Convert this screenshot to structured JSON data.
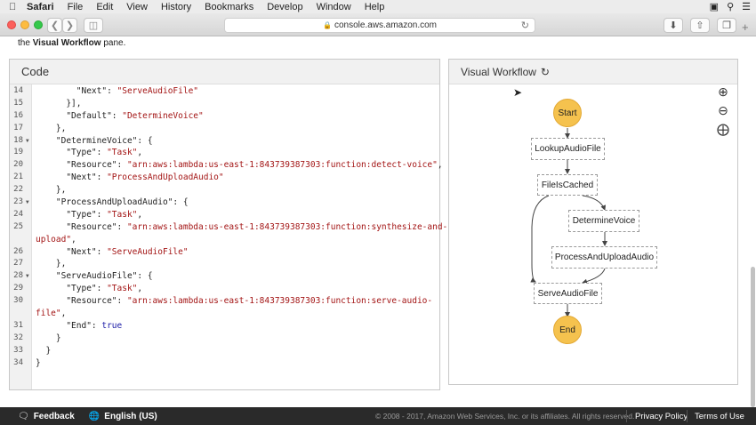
{
  "menubar": {
    "app": "Safari",
    "items": [
      "File",
      "Edit",
      "View",
      "History",
      "Bookmarks",
      "Develop",
      "Window",
      "Help"
    ]
  },
  "browser": {
    "url": "console.aws.amazon.com"
  },
  "intro": {
    "prefix": "the ",
    "bold": "Visual Workflow",
    "suffix": " pane."
  },
  "code_panel": {
    "title": "Code",
    "lines": [
      {
        "n": "14",
        "fold": false,
        "parts": [
          [
            "k",
            "        \"Next\": "
          ],
          [
            "s",
            "\"ServeAudioFile\""
          ]
        ]
      },
      {
        "n": "15",
        "fold": false,
        "parts": [
          [
            "k",
            "      }],"
          ]
        ]
      },
      {
        "n": "16",
        "fold": false,
        "parts": [
          [
            "k",
            "      \"Default\": "
          ],
          [
            "s",
            "\"DetermineVoice\""
          ]
        ]
      },
      {
        "n": "17",
        "fold": false,
        "parts": [
          [
            "k",
            "    },"
          ]
        ]
      },
      {
        "n": "18",
        "fold": true,
        "parts": [
          [
            "k",
            "    \"DetermineVoice\": {"
          ]
        ]
      },
      {
        "n": "19",
        "fold": false,
        "parts": [
          [
            "k",
            "      \"Type\": "
          ],
          [
            "s",
            "\"Task\""
          ],
          [
            "k",
            ","
          ]
        ]
      },
      {
        "n": "20",
        "fold": false,
        "parts": [
          [
            "k",
            "      \"Resource\": "
          ],
          [
            "s",
            "\"arn:aws:lambda:us-east-1:843739387303:function:detect-voice\""
          ],
          [
            "k",
            ","
          ]
        ]
      },
      {
        "n": "21",
        "fold": false,
        "parts": [
          [
            "k",
            "      \"Next\": "
          ],
          [
            "s",
            "\"ProcessAndUploadAudio\""
          ]
        ]
      },
      {
        "n": "22",
        "fold": false,
        "parts": [
          [
            "k",
            "    },"
          ]
        ]
      },
      {
        "n": "23",
        "fold": true,
        "parts": [
          [
            "k",
            "    \"ProcessAndUploadAudio\": {"
          ]
        ]
      },
      {
        "n": "24",
        "fold": false,
        "parts": [
          [
            "k",
            "      \"Type\": "
          ],
          [
            "s",
            "\"Task\""
          ],
          [
            "k",
            ","
          ]
        ]
      },
      {
        "n": "25",
        "fold": false,
        "parts": [
          [
            "k",
            "      \"Resource\": "
          ],
          [
            "s",
            "\"arn:aws:lambda:us-east-1:843739387303:function:synthesize-and-"
          ]
        ]
      },
      {
        "n": "",
        "fold": false,
        "parts": [
          [
            "s",
            "upload\""
          ],
          [
            "k",
            ","
          ]
        ]
      },
      {
        "n": "26",
        "fold": false,
        "parts": [
          [
            "k",
            "      \"Next\": "
          ],
          [
            "s",
            "\"ServeAudioFile\""
          ]
        ]
      },
      {
        "n": "27",
        "fold": false,
        "parts": [
          [
            "k",
            "    },"
          ]
        ]
      },
      {
        "n": "28",
        "fold": true,
        "parts": [
          [
            "k",
            "    \"ServeAudioFile\": {"
          ]
        ]
      },
      {
        "n": "29",
        "fold": false,
        "parts": [
          [
            "k",
            "      \"Type\": "
          ],
          [
            "s",
            "\"Task\""
          ],
          [
            "k",
            ","
          ]
        ]
      },
      {
        "n": "30",
        "fold": false,
        "parts": [
          [
            "k",
            "      \"Resource\": "
          ],
          [
            "s",
            "\"arn:aws:lambda:us-east-1:843739387303:function:serve-audio-"
          ]
        ]
      },
      {
        "n": "",
        "fold": false,
        "parts": [
          [
            "s",
            "file\""
          ],
          [
            "k",
            ","
          ]
        ]
      },
      {
        "n": "31",
        "fold": false,
        "parts": [
          [
            "k",
            "      \"End\": "
          ],
          [
            "b",
            "true"
          ]
        ]
      },
      {
        "n": "32",
        "fold": false,
        "parts": [
          [
            "k",
            "    }"
          ]
        ]
      },
      {
        "n": "33",
        "fold": false,
        "parts": [
          [
            "k",
            "  }"
          ]
        ]
      },
      {
        "n": "34",
        "fold": false,
        "parts": [
          [
            "k",
            "}"
          ]
        ]
      }
    ]
  },
  "visual_workflow": {
    "title": "Visual Workflow",
    "nodes": {
      "start": "Start",
      "lookup": "LookupAudioFile",
      "filecached": "FileIsCached",
      "determine": "DetermineVoice",
      "process": "ProcessAndUploadAudio",
      "serve": "ServeAudioFile",
      "end": "End"
    }
  },
  "footer": {
    "feedback": "Feedback",
    "language": "English (US)",
    "copyright": "© 2008 - 2017, Amazon Web Services, Inc. or its affiliates. All rights reserved.",
    "privacy": "Privacy Policy",
    "terms": "Terms of Use"
  }
}
